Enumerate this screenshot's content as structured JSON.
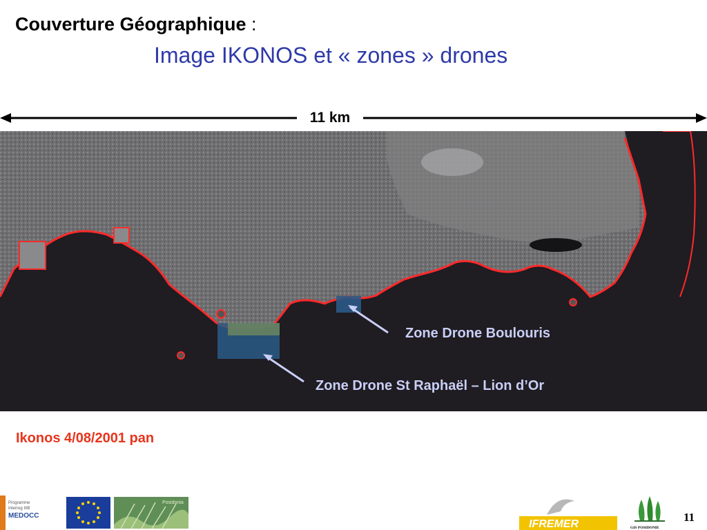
{
  "title": {
    "main": "Couverture Géographique",
    "colon": " :",
    "subtitle": "Image IKONOS et « zones » drones"
  },
  "scale": {
    "label": "11 km"
  },
  "map": {
    "zones": [
      {
        "label": "Zone Drone Boulouris"
      },
      {
        "label": "Zone Drone St Raphaël – Lion d’Or"
      }
    ],
    "colors": {
      "sea": "#1f1c22",
      "coastline": "#ff2a2a",
      "land": "#7a7a7c",
      "zone_overlay": "#2a5a86",
      "leader_line": "#c9cff5"
    }
  },
  "caption": "Ikonos 4/08/2001 pan",
  "logos": {
    "medocc_line1": "Programme",
    "medocc_line2": "Interreg IIIB",
    "medocc_name": "MEDOCC",
    "posidonia": "Posidonia",
    "ifremer": "IFREMER",
    "gis": "GIS POSIDONIE"
  },
  "page_number": "11"
}
